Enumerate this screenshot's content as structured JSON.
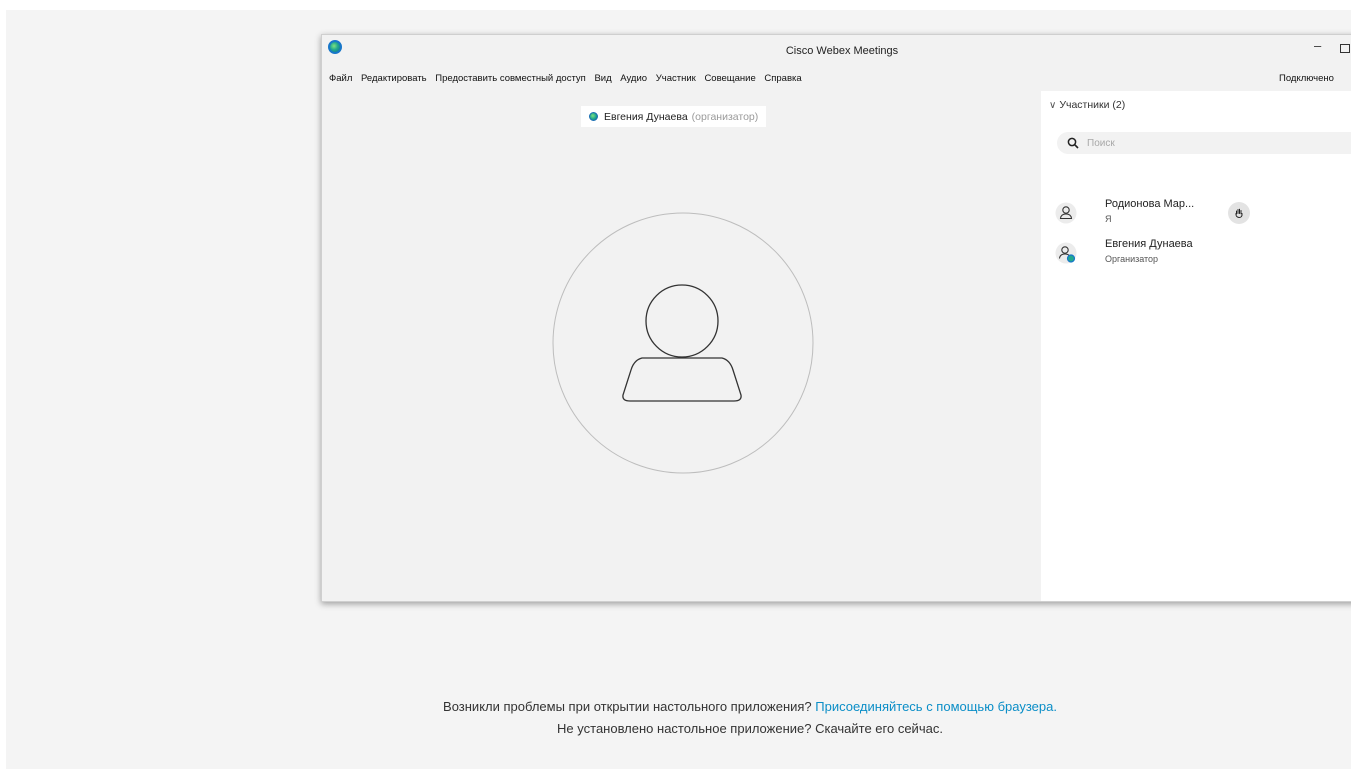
{
  "window": {
    "title": "Cisco Webex Meetings",
    "minimize_glyph": "–",
    "connection_status": "Подключено"
  },
  "menu": {
    "items": [
      {
        "label": "Файл"
      },
      {
        "label": "Редактировать"
      },
      {
        "label": "Предоставить совместный доступ"
      },
      {
        "label": "Вид"
      },
      {
        "label": "Аудио"
      },
      {
        "label": "Участник"
      },
      {
        "label": "Совещание"
      },
      {
        "label": "Справка"
      }
    ]
  },
  "video": {
    "speaker_name": "Евгения Дунаева",
    "speaker_role": "(организатор)"
  },
  "participants": {
    "header": "Участники (2)",
    "search_placeholder": "Поиск",
    "list": [
      {
        "name": "Родионова Мар...",
        "subtitle": "Я",
        "icon": "person-icon",
        "has_raise_hand": true
      },
      {
        "name": "Евгения Дунаева",
        "subtitle": "Организатор",
        "icon": "host-person-icon",
        "has_raise_hand": false
      }
    ]
  },
  "footer": {
    "line1_prefix": "Возникли проблемы при открытии настольного приложения?",
    "line1_link": "Присоединяйтесь с помощью браузера.",
    "line2": "Не установлено настольное приложение? Скачайте его сейчас."
  },
  "colors": {
    "link": "#0b8ec7",
    "accent_teal": "#22a88f",
    "accent_blue": "#1877c9"
  }
}
